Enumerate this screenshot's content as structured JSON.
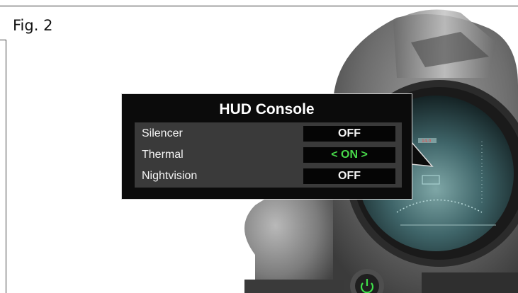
{
  "figure": {
    "label": "Fig. 2"
  },
  "hud": {
    "title": "HUD Console",
    "items": [
      {
        "label": "Silencer",
        "value": "OFF",
        "active": false
      },
      {
        "label": "Thermal",
        "value": "< ON >",
        "active": true
      },
      {
        "label": "Nightvision",
        "value": "OFF",
        "active": false
      }
    ]
  },
  "colors": {
    "active_value": "#48d94a",
    "power_icon": "#3fe04a",
    "panel": "#3a3a3a",
    "value_bg": "#050505"
  },
  "icons": {
    "power": "power-icon"
  }
}
